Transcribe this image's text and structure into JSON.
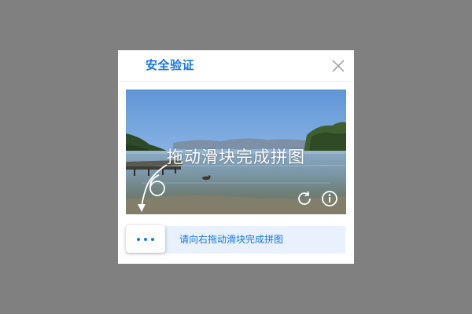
{
  "dialog": {
    "title": "安全验证",
    "close_icon": "close-icon"
  },
  "captcha": {
    "overlay_text": "拖动滑块完成拼图",
    "refresh_icon": "refresh-icon",
    "info_icon": "info-icon"
  },
  "slider": {
    "instruction": "请向右拖动滑块完成拼图",
    "handle_icon": "more-dots-icon",
    "progress": 0
  },
  "colors": {
    "accent": "#1677e6",
    "track": "#e8f1fd",
    "backdrop": "#808080"
  }
}
